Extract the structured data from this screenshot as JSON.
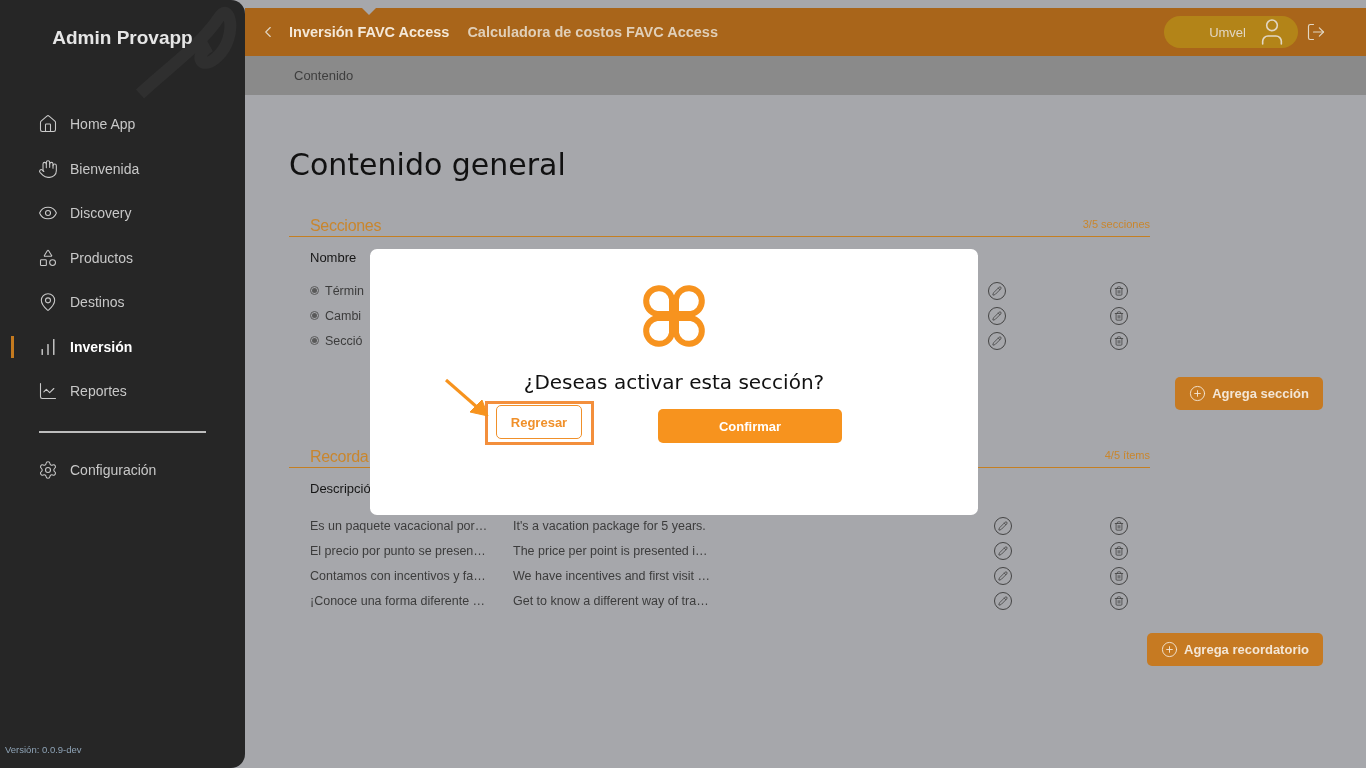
{
  "sidebar": {
    "title": "Admin Provapp",
    "items": [
      {
        "label": "Home App",
        "selected": false
      },
      {
        "label": "Bienvenida",
        "selected": false
      },
      {
        "label": "Discovery",
        "selected": false
      },
      {
        "label": "Productos",
        "selected": false
      },
      {
        "label": "Destinos",
        "selected": false
      },
      {
        "label": "Inversión",
        "selected": true
      },
      {
        "label": "Reportes",
        "selected": false
      }
    ],
    "footer_items": [
      {
        "label": "Configuración",
        "selected": false
      }
    ],
    "version": "Versión: 0.0.9-dev"
  },
  "topbar": {
    "tabs": [
      {
        "label": "Inversión FAVC Access",
        "selected": true
      },
      {
        "label": "Calculadora de costos FAVC Access",
        "selected": false
      }
    ],
    "user": {
      "name": "Umvel"
    }
  },
  "breadcrumb": "Contenido",
  "page_title": "Contenido general",
  "sections": {
    "title": "Secciones",
    "count": "3/5 secciones",
    "columns": [
      "Nombre"
    ],
    "rows": [
      {
        "name": "Términ"
      },
      {
        "name": "Cambi"
      },
      {
        "name": "Secció"
      }
    ],
    "add_button": "Agrega sección"
  },
  "reminders": {
    "title": "Recorda",
    "count": "4/5 ítems",
    "columns": [
      "Descripció"
    ],
    "rows": [
      {
        "es": "Es un paquete vacacional por…",
        "en": "It's a vacation package for 5 years."
      },
      {
        "es": "El precio por punto se presen…",
        "en": "The price per point is presented i…"
      },
      {
        "es": "Contamos con incentivos y fa…",
        "en": "We have incentives and first visit …"
      },
      {
        "es": "¡Conoce una forma diferente …",
        "en": "Get to know a different way of tra…"
      }
    ],
    "add_button": "Agrega recordatorio"
  },
  "dialog": {
    "question": "¿Deseas activar esta sección?",
    "buttons": [
      {
        "label": "Regresar",
        "kind": "secondary",
        "highlighted": true
      },
      {
        "label": "Confirmar",
        "kind": "primary",
        "highlighted": false
      }
    ]
  }
}
